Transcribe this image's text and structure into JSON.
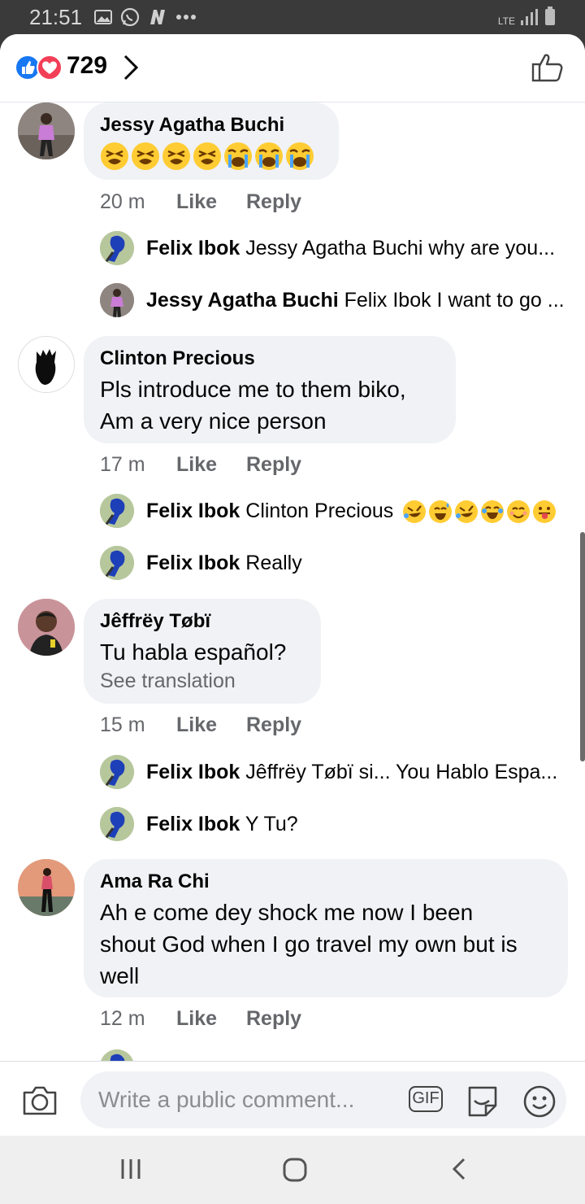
{
  "status_bar": {
    "time": "21:51",
    "network": "LTE"
  },
  "reactions": {
    "count": "729"
  },
  "comments": [
    {
      "author": "Jessy Agatha Buchi",
      "text": "",
      "time": "20 m",
      "like": "Like",
      "reply": "Reply",
      "replies": [
        {
          "author": "Felix Ibok",
          "text": "Jessy Agatha Buchi why are you..."
        },
        {
          "author": "Jessy Agatha Buchi",
          "text": "Felix Ibok I want to go ..."
        }
      ]
    },
    {
      "author": "Clinton Precious",
      "text_line1": "Pls introduce me to them biko,",
      "text_line2": "Am a very nice person",
      "time": "17 m",
      "like": "Like",
      "reply": "Reply",
      "replies": [
        {
          "author": "Felix Ibok",
          "text": "Clinton Precious"
        },
        {
          "author": "Felix Ibok",
          "text": "Really"
        }
      ]
    },
    {
      "author": "Jêffrëy Tøbï",
      "text": "Tu habla español?",
      "translate": "See translation",
      "time": "15 m",
      "like": "Like",
      "reply": "Reply",
      "replies": [
        {
          "author": "Felix Ibok",
          "text": "Jêffrëy Tøbï si... You Hablo Espa..."
        },
        {
          "author": "Felix Ibok",
          "text": "Y Tu?"
        }
      ]
    },
    {
      "author": "Ama Ra Chi",
      "text_line1": "Ah e come dey shock me now I been",
      "text_line2": "shout God when I go travel my own but is",
      "text_line3": "well",
      "time": "12 m",
      "like": "Like",
      "reply": "Reply"
    }
  ],
  "composer": {
    "placeholder": "Write a public comment...",
    "gif_label": "GIF"
  },
  "colors": {
    "like_blue": "#1877f2",
    "love_red": "#f33e58",
    "bubble_bg": "#f0f2f5",
    "meta_gray": "#65676b"
  },
  "icons": {
    "camera": "camera-icon",
    "sticker": "sticker-icon",
    "emoji": "emoji-icon",
    "like": "thumbs-up-icon"
  }
}
